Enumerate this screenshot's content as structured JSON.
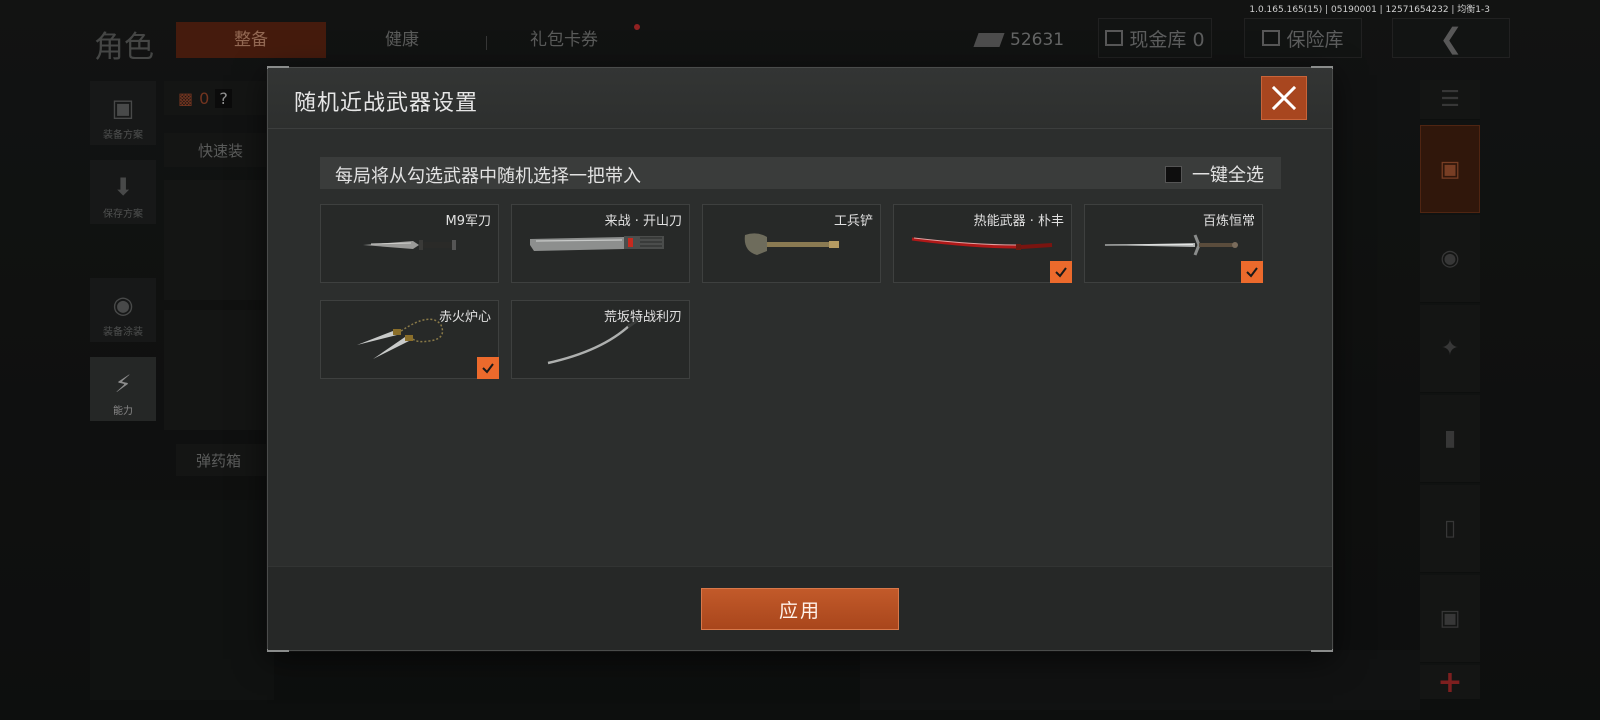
{
  "version_text": "1.0.165.165(15) | 05190001 | 12571654232 | 均衡1-3",
  "background": {
    "role_title": "角色",
    "tabs": [
      {
        "label": "整备",
        "active": true
      },
      {
        "label": "健康",
        "active": false
      },
      {
        "label": "礼包卡券",
        "active": false
      }
    ],
    "currency_value": "52631",
    "cash_vault_label": "现金库 0",
    "safe_label": "保险库",
    "left_icons": [
      {
        "label": "装备方案",
        "icon": "backpack-icon"
      },
      {
        "label": "保存方案",
        "icon": "download-icon"
      },
      {
        "label": "装备涂装",
        "icon": "helmet-icon"
      },
      {
        "label": "能力",
        "icon": "lightning-hexagon-icon"
      }
    ],
    "quick_equip_label": "快速装",
    "ammo_label": "弹药箱",
    "loadout_count": "0"
  },
  "modal": {
    "title": "随机近战武器设置",
    "instruction": "每局将从勾选武器中随机选择一把带入",
    "select_all_label": "一键全选",
    "select_all_checked": false,
    "weapons": [
      {
        "name": "M9军刀",
        "checked": false,
        "icon": "combat-knife-icon"
      },
      {
        "name": "来战 · 开山刀",
        "checked": false,
        "icon": "machete-icon"
      },
      {
        "name": "工兵铲",
        "checked": false,
        "icon": "shovel-icon"
      },
      {
        "name": "热能武器 · 朴丰",
        "checked": true,
        "icon": "red-katana-icon"
      },
      {
        "name": "百炼恒常",
        "checked": true,
        "icon": "longsword-icon"
      },
      {
        "name": "赤火炉心",
        "checked": true,
        "icon": "chained-daggers-icon"
      },
      {
        "name": "荒坂特战利刃",
        "checked": false,
        "icon": "curved-blade-icon"
      }
    ],
    "apply_label": "应用"
  },
  "colors": {
    "accent": "#ec6a2c",
    "close_bg": "#a8461f",
    "apply_bg": "#b34f22"
  }
}
